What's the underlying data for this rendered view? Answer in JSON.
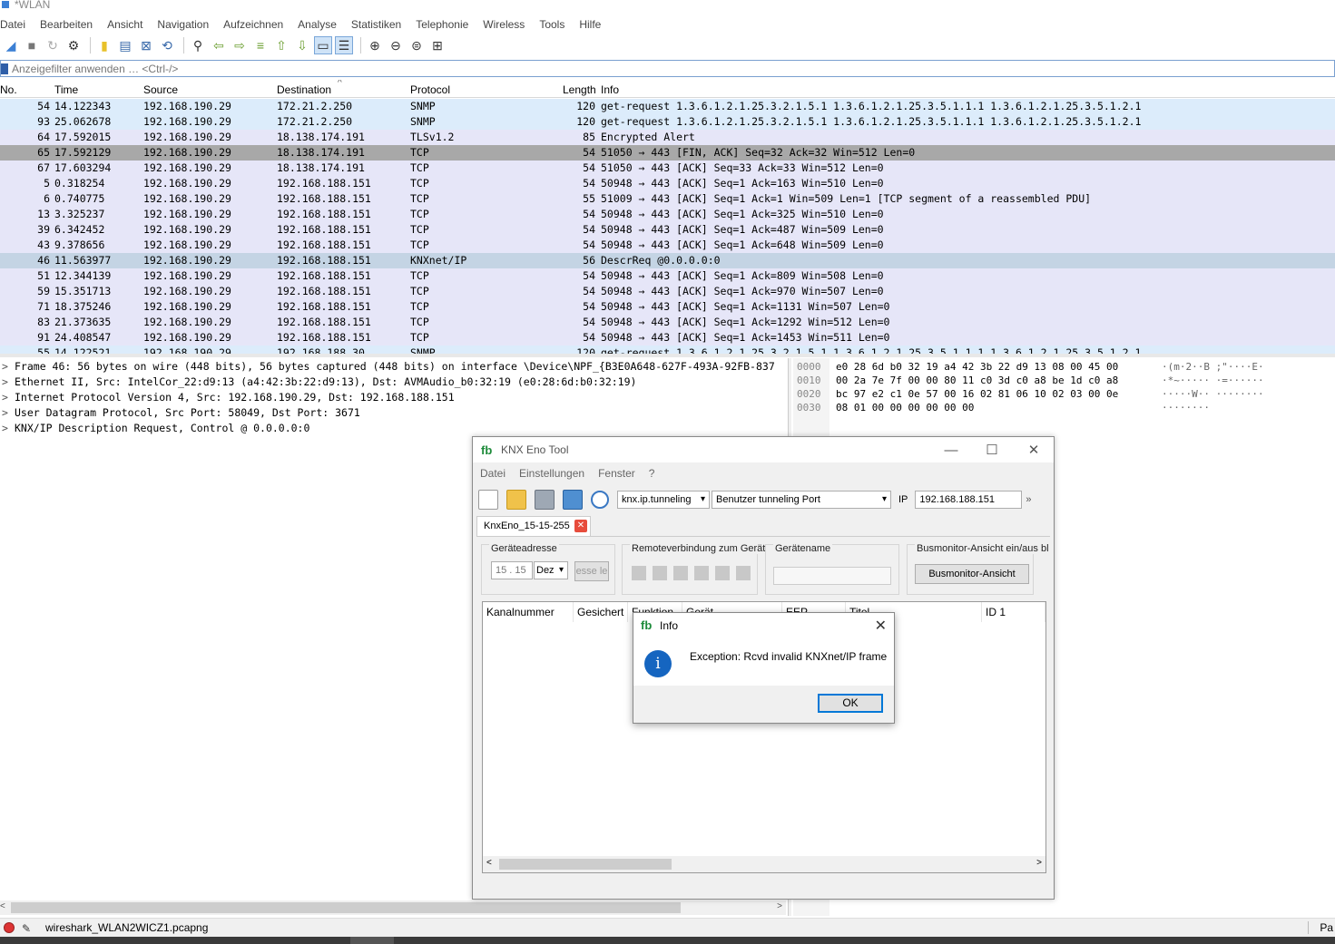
{
  "window": {
    "title": "*WLAN"
  },
  "menu": [
    "Datei",
    "Bearbeiten",
    "Ansicht",
    "Navigation",
    "Aufzeichnen",
    "Analyse",
    "Statistiken",
    "Telephonie",
    "Wireless",
    "Tools",
    "Hilfe"
  ],
  "filter": {
    "placeholder": "Anzeigefilter anwenden … <Ctrl-/>"
  },
  "columns": {
    "no": "No.",
    "time": "Time",
    "source": "Source",
    "destination": "Destination",
    "protocol": "Protocol",
    "length": "Length",
    "info": "Info"
  },
  "packets": [
    {
      "no": "54",
      "time": "14.122343",
      "src": "192.168.190.29",
      "dst": "172.21.2.250",
      "proto": "SNMP",
      "len": "120",
      "info": "get-request 1.3.6.1.2.1.25.3.2.1.5.1 1.3.6.1.2.1.25.3.5.1.1.1 1.3.6.1.2.1.25.3.5.1.2.1"
    },
    {
      "no": "93",
      "time": "25.062678",
      "src": "192.168.190.29",
      "dst": "172.21.2.250",
      "proto": "SNMP",
      "len": "120",
      "info": "get-request 1.3.6.1.2.1.25.3.2.1.5.1 1.3.6.1.2.1.25.3.5.1.1.1 1.3.6.1.2.1.25.3.5.1.2.1"
    },
    {
      "no": "64",
      "time": "17.592015",
      "src": "192.168.190.29",
      "dst": "18.138.174.191",
      "proto": "TLSv1.2",
      "len": "85",
      "info": "Encrypted Alert"
    },
    {
      "no": "65",
      "time": "17.592129",
      "src": "192.168.190.29",
      "dst": "18.138.174.191",
      "proto": "TCP",
      "len": "54",
      "info": "51050 → 443 [FIN, ACK] Seq=32 Ack=32 Win=512 Len=0"
    },
    {
      "no": "67",
      "time": "17.603294",
      "src": "192.168.190.29",
      "dst": "18.138.174.191",
      "proto": "TCP",
      "len": "54",
      "info": "51050 → 443 [ACK] Seq=33 Ack=33 Win=512 Len=0"
    },
    {
      "no": "5",
      "time": "0.318254",
      "src": "192.168.190.29",
      "dst": "192.168.188.151",
      "proto": "TCP",
      "len": "54",
      "info": "50948 → 443 [ACK] Seq=1 Ack=163 Win=510 Len=0"
    },
    {
      "no": "6",
      "time": "0.740775",
      "src": "192.168.190.29",
      "dst": "192.168.188.151",
      "proto": "TCP",
      "len": "55",
      "info": "51009 → 443 [ACK] Seq=1 Ack=1 Win=509 Len=1 [TCP segment of a reassembled PDU]"
    },
    {
      "no": "13",
      "time": "3.325237",
      "src": "192.168.190.29",
      "dst": "192.168.188.151",
      "proto": "TCP",
      "len": "54",
      "info": "50948 → 443 [ACK] Seq=1 Ack=325 Win=510 Len=0"
    },
    {
      "no": "39",
      "time": "6.342452",
      "src": "192.168.190.29",
      "dst": "192.168.188.151",
      "proto": "TCP",
      "len": "54",
      "info": "50948 → 443 [ACK] Seq=1 Ack=487 Win=509 Len=0"
    },
    {
      "no": "43",
      "time": "9.378656",
      "src": "192.168.190.29",
      "dst": "192.168.188.151",
      "proto": "TCP",
      "len": "54",
      "info": "50948 → 443 [ACK] Seq=1 Ack=648 Win=509 Len=0"
    },
    {
      "no": "46",
      "time": "11.563977",
      "src": "192.168.190.29",
      "dst": "192.168.188.151",
      "proto": "KNXnet/IP",
      "len": "56",
      "info": "DescrReq @0.0.0.0:0"
    },
    {
      "no": "51",
      "time": "12.344139",
      "src": "192.168.190.29",
      "dst": "192.168.188.151",
      "proto": "TCP",
      "len": "54",
      "info": "50948 → 443 [ACK] Seq=1 Ack=809 Win=508 Len=0"
    },
    {
      "no": "59",
      "time": "15.351713",
      "src": "192.168.190.29",
      "dst": "192.168.188.151",
      "proto": "TCP",
      "len": "54",
      "info": "50948 → 443 [ACK] Seq=1 Ack=970 Win=507 Len=0"
    },
    {
      "no": "71",
      "time": "18.375246",
      "src": "192.168.190.29",
      "dst": "192.168.188.151",
      "proto": "TCP",
      "len": "54",
      "info": "50948 → 443 [ACK] Seq=1 Ack=1131 Win=507 Len=0"
    },
    {
      "no": "83",
      "time": "21.373635",
      "src": "192.168.190.29",
      "dst": "192.168.188.151",
      "proto": "TCP",
      "len": "54",
      "info": "50948 → 443 [ACK] Seq=1 Ack=1292 Win=512 Len=0"
    },
    {
      "no": "91",
      "time": "24.408547",
      "src": "192.168.190.29",
      "dst": "192.168.188.151",
      "proto": "TCP",
      "len": "54",
      "info": "50948 → 443 [ACK] Seq=1 Ack=1453 Win=511 Len=0"
    },
    {
      "no": "55",
      "time": "14.122521",
      "src": "192.168.190.29",
      "dst": "192.168.188.30",
      "proto": "SNMP",
      "len": "120",
      "info": "get-request 1.3.6.1.2.1.25.3.2.1.5.1 1.3.6.1.2.1.25.3.5.1.1.1 1.3.6.1.2.1.25.3.5.1.2.1"
    }
  ],
  "details": [
    "Frame 46: 56 bytes on wire (448 bits), 56 bytes captured (448 bits) on interface \\Device\\NPF_{B3E0A648-627F-493A-92FB-837",
    "Ethernet II, Src: IntelCor_22:d9:13 (a4:42:3b:22:d9:13), Dst: AVMAudio_b0:32:19 (e0:28:6d:b0:32:19)",
    "Internet Protocol Version 4, Src: 192.168.190.29, Dst: 192.168.188.151",
    "User Datagram Protocol, Src Port: 58049, Dst Port: 3671",
    "KNX/IP Description Request, Control @ 0.0.0.0:0"
  ],
  "bytes": [
    {
      "off": "0000",
      "hex": "e0 28 6d b0 32 19 a4 42  3b 22 d9 13 08 00 45 00",
      "ascii": "·(m·2··B ;\"····E·"
    },
    {
      "off": "0010",
      "hex": "00 2a 7e 7f 00 00 80 11  c0 3d c0 a8 be 1d c0 a8",
      "ascii": "·*~····· ·=······"
    },
    {
      "off": "0020",
      "hex": "bc 97 e2 c1 0e 57 00 16  02 81 06 10 02 03 00 0e",
      "ascii": "·····W·· ········"
    },
    {
      "off": "0030",
      "hex": "08 01 00 00 00 00 00 00",
      "ascii": "········"
    }
  ],
  "status": {
    "file": "wireshark_WLAN2WICZ1.pcapng",
    "right": "Pa"
  },
  "knx": {
    "title": "KNX Eno Tool",
    "menu": [
      "Datei",
      "Einstellungen",
      "Fenster",
      "?"
    ],
    "mode": "knx.ip.tunneling",
    "port": "Benutzer tunneling Port",
    "ip_label": "IP",
    "ip": "192.168.188.151",
    "tab": "KnxEno_15-15-255",
    "grp_addr": "Geräteadresse",
    "addr_value": "15 . 15",
    "addr_fmt": "Dez",
    "addr_btn": "esse le",
    "grp_remote": "Remoteverbindung zum Gerät",
    "grp_name": "Gerätename",
    "grp_bus": "Busmonitor-Ansicht ein/aus bl",
    "bus_btn": "Busmonitor-Ansicht",
    "cols": [
      "Kanalnummer",
      "Gesichert",
      "Funktion",
      "Gerät",
      "EEP",
      "Titel",
      "ID 1"
    ]
  },
  "dialog": {
    "title": "Info",
    "message": "Exception: Rcvd invalid KNXnet/IP frame",
    "ok": "OK"
  },
  "colors": {
    "snmp": "#dcecfb",
    "tcp": "#e6e6f8",
    "knx": "#c4d4e4",
    "selected": "#a8a8a8"
  }
}
